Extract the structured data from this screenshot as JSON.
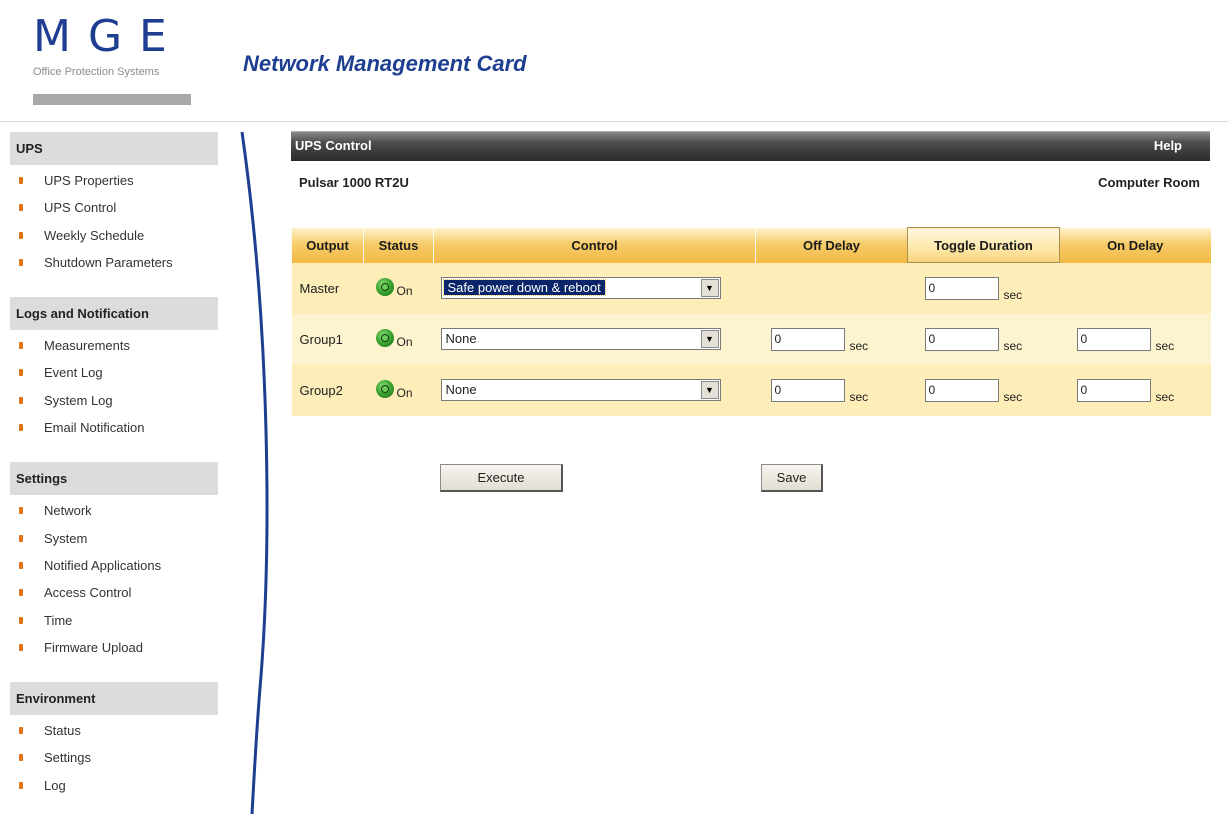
{
  "header": {
    "logo_letters": "MGE",
    "logo_subtitle": "Office Protection Systems",
    "app_title": "Network  Management  Card"
  },
  "sidebar": {
    "sections": [
      {
        "title": "UPS",
        "items": [
          "UPS Properties",
          "UPS Control",
          "Weekly Schedule",
          "Shutdown Parameters"
        ]
      },
      {
        "title": "Logs and Notification",
        "items": [
          "Measurements",
          "Event Log",
          "System Log",
          "Email Notification"
        ]
      },
      {
        "title": "Settings",
        "items": [
          "Network",
          "System",
          "Notified Applications",
          "Access Control",
          "Time",
          "Firmware Upload"
        ]
      },
      {
        "title": "Environment",
        "items": [
          "Status",
          "Settings",
          "Log"
        ]
      }
    ]
  },
  "panel": {
    "title": "UPS Control",
    "help_label": "Help",
    "ups_model": "Pulsar 1000 RT2U",
    "location": "Computer Room"
  },
  "table": {
    "columns": [
      "Output",
      "Status",
      "Control",
      "Off Delay",
      "Toggle Duration",
      "On Delay"
    ],
    "rows": [
      {
        "output": "Master",
        "status": "On",
        "control": "Safe power down & reboot",
        "off_delay": "",
        "toggle_duration": "0",
        "on_delay": "",
        "unit": "sec"
      },
      {
        "output": "Group1",
        "status": "On",
        "control": "None",
        "off_delay": "0",
        "toggle_duration": "0",
        "on_delay": "0",
        "unit": "sec"
      },
      {
        "output": "Group2",
        "status": "On",
        "control": "None",
        "off_delay": "0",
        "toggle_duration": "0",
        "on_delay": "0",
        "unit": "sec"
      }
    ]
  },
  "buttons": {
    "execute_label": "Execute",
    "save_label": "Save"
  },
  "colors": {
    "brand_blue": "#1e3f91",
    "accent_orange": "#e17314",
    "table_header_gold": "#f7cc6a",
    "status_on_green": "#3ea734"
  }
}
